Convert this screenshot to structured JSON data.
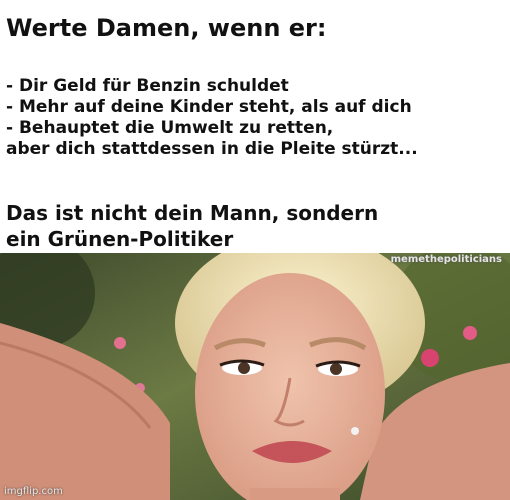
{
  "meme": {
    "title": "Werte Damen, wenn er:",
    "lines": [
      "- Dir Geld für Benzin schuldet",
      "- Mehr auf deine Kinder steht, als auf dich",
      "- Behauptet die Umwelt zu retten,",
      "aber dich stattdessen in die Pleite stürzt..."
    ],
    "punchline": [
      "Das ist nicht dein Mann, sondern",
      "ein Grünen-Politiker"
    ],
    "photo_watermark": "memethepoliticians",
    "imgflip_watermark": "imgflip.com"
  }
}
